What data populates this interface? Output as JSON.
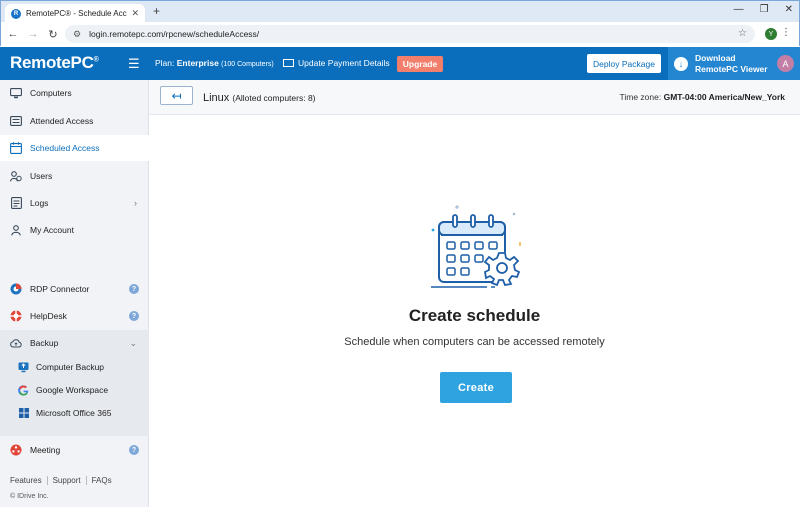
{
  "browser": {
    "tab_title": "RemotePC® - Schedule Access",
    "tab_favicon": "R",
    "url": "login.remotepc.com/rpcnew/scheduleAccess/",
    "profile_initial": "Y"
  },
  "header": {
    "logo": "RemotePC",
    "logo_mark": "®",
    "plan_label": "Plan:",
    "plan_name": "Enterprise",
    "plan_detail": "(100 Computers)",
    "update_payment": "Update Payment Details",
    "upgrade": "Upgrade",
    "deploy": "Deploy Package",
    "download_line1": "Download",
    "download_line2": "RemotePC Viewer",
    "avatar_initial": "A",
    "accent": "#0a6ebd",
    "upgrade_color": "#f27f6c"
  },
  "sidebar": {
    "items": [
      {
        "label": "Computers",
        "icon": "monitor-icon"
      },
      {
        "label": "Attended Access",
        "icon": "keyboard-icon"
      },
      {
        "label": "Scheduled Access",
        "icon": "calendar-icon"
      },
      {
        "label": "Users",
        "icon": "users-icon"
      },
      {
        "label": "Logs",
        "icon": "logs-icon"
      },
      {
        "label": "My Account",
        "icon": "person-icon"
      }
    ],
    "services": [
      {
        "label": "RDP Connector",
        "icon": "rdp-icon"
      },
      {
        "label": "HelpDesk",
        "icon": "lifebuoy-icon"
      },
      {
        "label": "Backup",
        "icon": "cloud-icon"
      }
    ],
    "backup_items": [
      {
        "label": "Computer Backup"
      },
      {
        "label": "Google Workspace"
      },
      {
        "label": "Microsoft Office 365"
      }
    ],
    "meeting": "Meeting",
    "footer_links": [
      "Features",
      "Support",
      "FAQs"
    ],
    "copyright": "© IDrive Inc."
  },
  "main": {
    "group_name": "Linux",
    "group_detail": "(Alloted computers: 8)",
    "timezone_label": "Time zone:",
    "timezone_value": "GMT-04:00 America/New_York",
    "empty_title": "Create schedule",
    "empty_subtitle": "Schedule when computers can be accessed remotely",
    "create_button": "Create"
  }
}
